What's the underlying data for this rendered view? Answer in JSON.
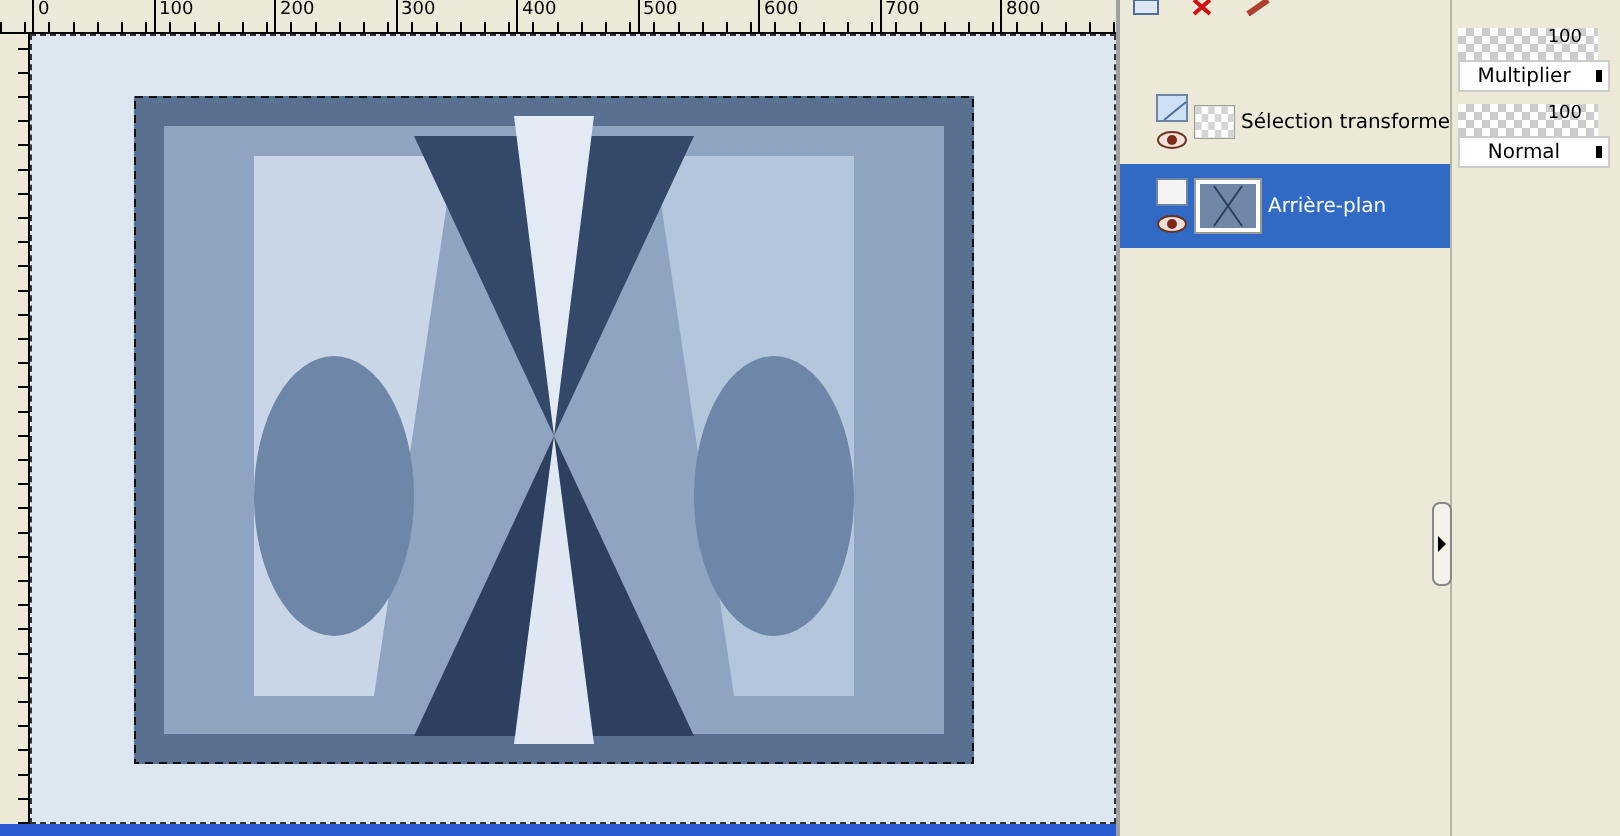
{
  "ruler": {
    "labels": [
      "0",
      "100",
      "200",
      "300",
      "400",
      "500",
      "600",
      "700",
      "800"
    ]
  },
  "layers": [
    {
      "name": "Sélection transforme",
      "selected": false,
      "kind": "raster",
      "opacity": "100",
      "blend_mode": "Multiplier"
    },
    {
      "name": "Arrière-plan",
      "selected": true,
      "kind": "background",
      "opacity": "100",
      "blend_mode": "Normal"
    }
  ]
}
